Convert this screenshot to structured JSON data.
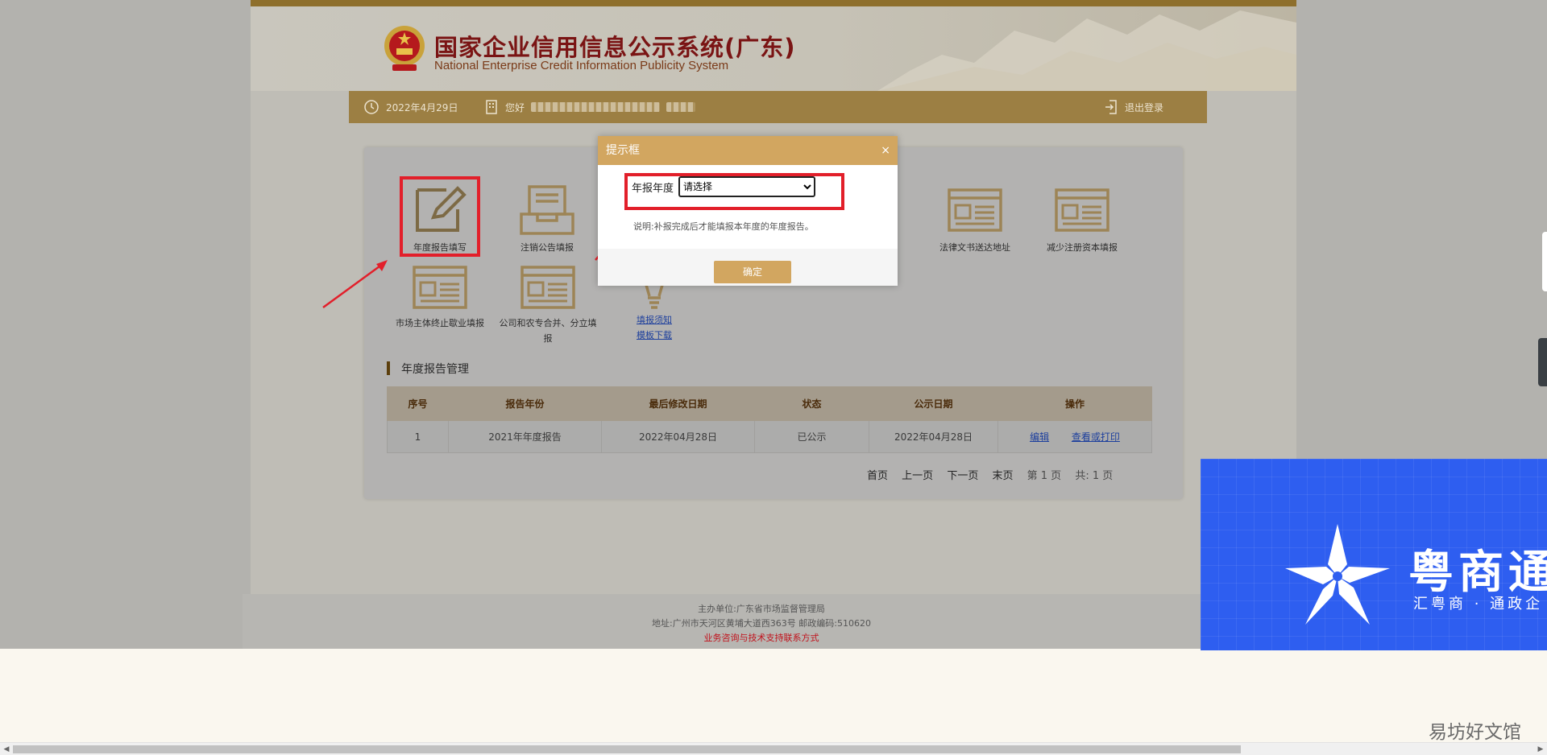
{
  "header": {
    "title": "国家企业信用信息公示系统(广东)",
    "subtitle": "National Enterprise Credit Information Publicity System"
  },
  "navbar": {
    "date": "2022年4月29日",
    "greeting": "您好",
    "logout": "退出登录"
  },
  "tiles": [
    {
      "label": "年度报告填写",
      "icon": "pencil-edit-icon"
    },
    {
      "label": "注销公告填报",
      "icon": "inbox-tray-icon"
    },
    {
      "label": "法律文书送达地址",
      "icon": "document-list-icon"
    },
    {
      "label": "减少注册资本填报",
      "icon": "document-list-icon"
    },
    {
      "label": "市场主体终止歇业填报",
      "icon": "document-list-icon"
    },
    {
      "label": "公司和农专合并、分立填报",
      "icon": "document-list-icon"
    },
    {
      "label": "填报须知",
      "label2": "模板下载",
      "icon": "lightbulb-icon"
    }
  ],
  "section": {
    "title": "年度报告管理"
  },
  "table": {
    "headers": [
      "序号",
      "报告年份",
      "最后修改日期",
      "状态",
      "公示日期",
      "操作"
    ],
    "rows": [
      {
        "seq": "1",
        "year": "2021年年度报告",
        "modified": "2022年04月28日",
        "status": "已公示",
        "published": "2022年04月28日",
        "edit": "编辑",
        "view": "查看或打印"
      }
    ]
  },
  "pager": {
    "first": "首页",
    "prev": "上一页",
    "next": "下一页",
    "last": "末页",
    "page_info": "第 1 页",
    "total_info": "共:  1 页"
  },
  "footer": {
    "sponsor": "主办单位:广东省市场监督管理局",
    "address": "地址:广州市天河区黄埔大道西363号   邮政编码:510620",
    "contact": "业务咨询与技术支持联系方式"
  },
  "modal": {
    "title": "提示框",
    "close": "×",
    "field_label": "年报年度",
    "select_value": "请选择",
    "note": "说明:补报完成后才能填报本年度的年度报告。",
    "confirm": "确定"
  },
  "ad": {
    "brand": "粤商通",
    "slogan": "汇粤商 · 通政企"
  },
  "watermark": "易坊好文馆",
  "colors": {
    "accent_gold": "#d2a660",
    "highlight_red": "#e21f2a",
    "title_red": "#7a1414",
    "ad_blue": "#2e5ef0"
  }
}
